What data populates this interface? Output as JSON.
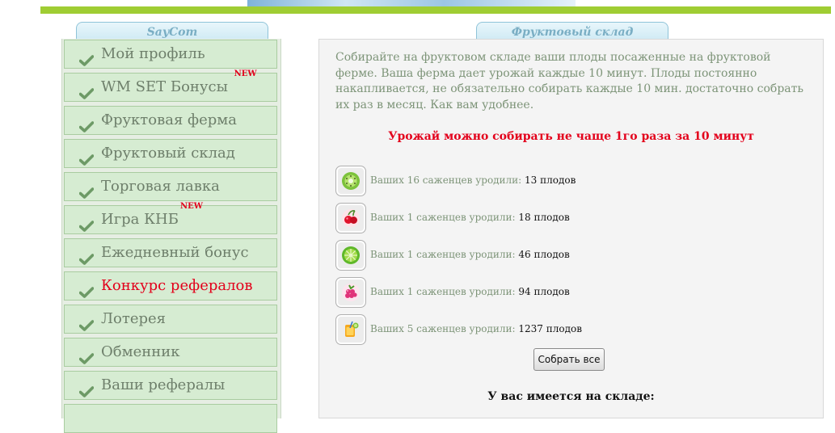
{
  "colors": {
    "accent_bar": "#9fcd33",
    "menu_bg": "#d6ecd2",
    "alert": "#e3001b",
    "text_green": "#7d9478"
  },
  "sidebar": {
    "tab_title": "SayCom",
    "items": [
      {
        "label": "Мой профиль",
        "badge": "",
        "icon": "check-icon"
      },
      {
        "label": "WM SET Бонусы",
        "badge": "NEW",
        "icon": "check-icon"
      },
      {
        "label": "Фруктовая ферма",
        "badge": "",
        "icon": "check-icon"
      },
      {
        "label": "Фруктовый склад",
        "badge": "",
        "icon": "check-icon"
      },
      {
        "label": "Торговая лавка",
        "badge": "",
        "icon": "check-icon"
      },
      {
        "label": "Игра КНБ",
        "badge": "NEW",
        "icon": "check-icon"
      },
      {
        "label": "Ежедневный бонус",
        "badge": "",
        "icon": "check-icon"
      },
      {
        "label": "Конкурс рефералов",
        "badge": "",
        "icon": "check-icon"
      },
      {
        "label": "Лотерея",
        "badge": "",
        "icon": "check-icon"
      },
      {
        "label": "Обменник",
        "badge": "",
        "icon": "check-icon"
      },
      {
        "label": "Ваши рефералы",
        "badge": "",
        "icon": "check-icon"
      }
    ]
  },
  "main": {
    "tab_title": "Фруктовый склад",
    "intro": "Собирайте на фруктовом складе ваши плоды посаженные на фруктовой ферме. Ваша ферма дает урожай каждые 10 минут. Плоды постоянно накапливается, не обязательно собирать каждые 10 мин. достаточно собрать их раз в месяц. Как вам удобнее.",
    "warning": "Урожай можно собирать не чаще 1го раза за 10 минут",
    "fruits": [
      {
        "icon": "kiwi-icon",
        "label": "Ваших 16 саженцев уродили:",
        "count": "13 плодов"
      },
      {
        "icon": "cherry-icon",
        "label": "Ваших 1 саженцев уродили:",
        "count": "18 плодов"
      },
      {
        "icon": "lime-icon",
        "label": "Ваших 1 саженцев уродили:",
        "count": "46 плодов"
      },
      {
        "icon": "raspberry-icon",
        "label": "Ваших 1 саженцев уродили:",
        "count": "94 плодов"
      },
      {
        "icon": "juice-icon",
        "label": "Ваших 5 саженцев уродили:",
        "count": "1237 плодов"
      }
    ],
    "collect_button": "Собрать все",
    "stock_title": "У вас имеется на складе:"
  }
}
